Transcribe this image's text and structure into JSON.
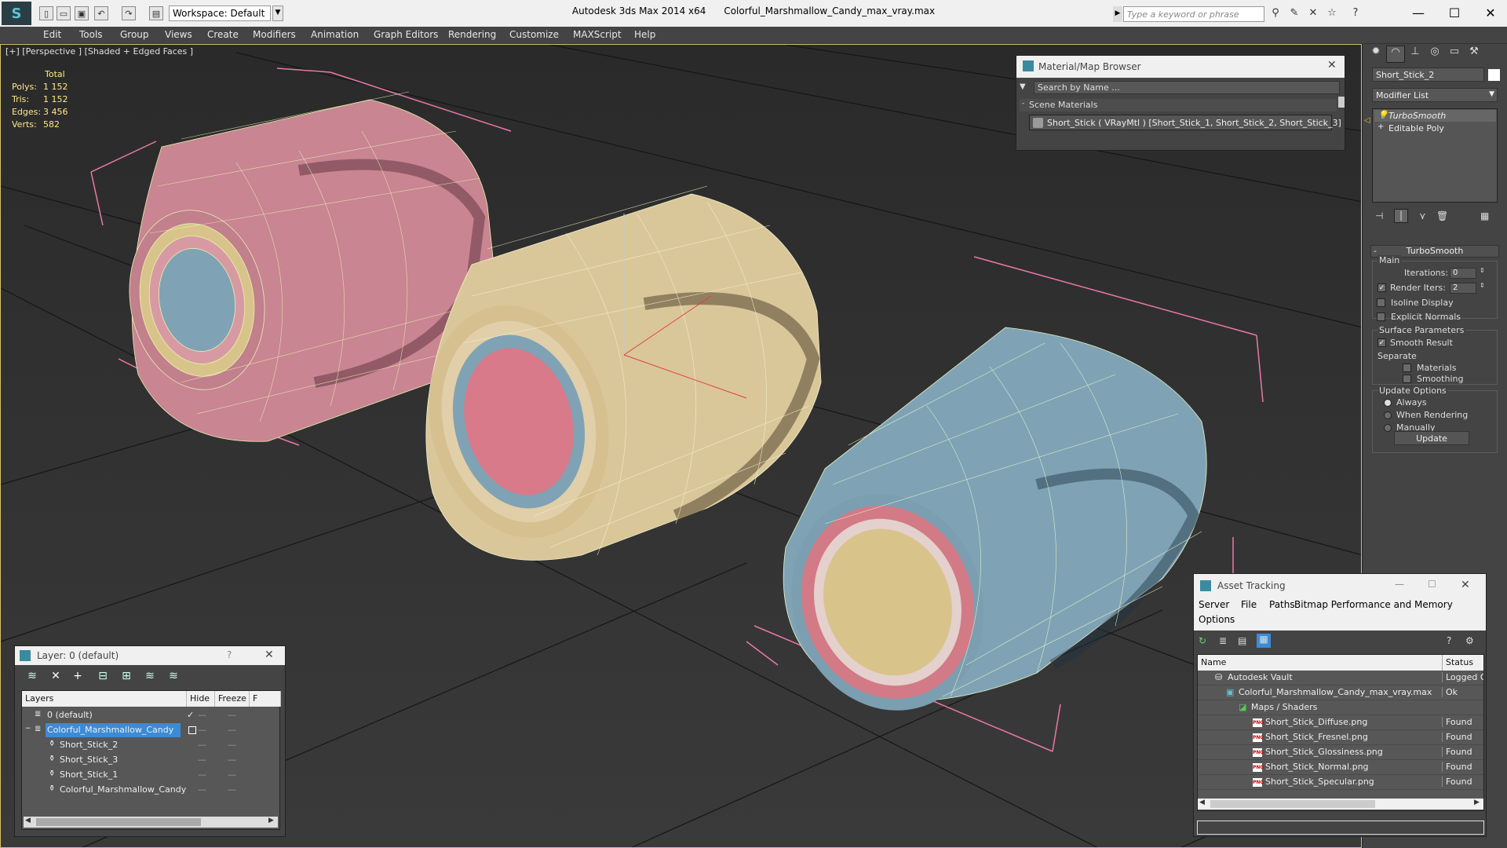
{
  "titlebar": {
    "workspace": "Workspace: Default",
    "app_name": "Autodesk 3ds Max  2014 x64",
    "file_name": "Colorful_Marshmallow_Candy_max_vray.max",
    "search_placeholder": "Type a keyword or phrase"
  },
  "menu": [
    "Edit",
    "Tools",
    "Group",
    "Views",
    "Create",
    "Modifiers",
    "Animation",
    "Graph Editors",
    "Rendering",
    "Customize",
    "MAXScript",
    "Help"
  ],
  "viewport": {
    "label": "[+] [Perspective ] [Shaded + Edged Faces ]",
    "stats_header": "Total",
    "stats": [
      {
        "label": "Polys:",
        "value": "1 152"
      },
      {
        "label": "Tris:",
        "value": "1 152"
      },
      {
        "label": "Edges:",
        "value": "3 456"
      },
      {
        "label": "Verts:",
        "value": "582"
      }
    ]
  },
  "material_browser": {
    "title": "Material/Map Browser",
    "search_placeholder": "Search by Name ...",
    "section": "Scene Materials",
    "material": "Short_Stick  ( VRayMtl )  [Short_Stick_1, Short_Stick_2, Short_Stick_3]"
  },
  "command_panel": {
    "object_name": "Short_Stick_2",
    "modifier_list": "Modifier List",
    "stack": [
      "TurboSmooth",
      "Editable Poly"
    ],
    "rollout_title": "TurboSmooth",
    "main_label": "Main",
    "iterations_label": "Iterations:",
    "iterations_value": "0",
    "render_iters_label": "Render Iters:",
    "render_iters_value": "2",
    "isoline": "Isoline Display",
    "explicit_normals": "Explicit Normals",
    "surface_params": "Surface Parameters",
    "smooth_result": "Smooth Result",
    "separate": "Separate",
    "materials": "Materials",
    "smoothing_groups": "Smoothing Groups",
    "update_options": "Update Options",
    "always": "Always",
    "when_rendering": "When Rendering",
    "manually": "Manually",
    "update_button": "Update"
  },
  "layer_panel": {
    "title": "Layer: 0 (default)",
    "help": "?",
    "columns": [
      "Layers",
      "Hide",
      "Freeze",
      "F"
    ],
    "rows": [
      {
        "name": "0 (default)",
        "hide": "—",
        "freeze": "—"
      },
      {
        "name": "Colorful_Marshmallow_Candy",
        "hide": "—",
        "freeze": "—"
      },
      {
        "name": "Short_Stick_2",
        "hide": "—",
        "freeze": "—"
      },
      {
        "name": "Short_Stick_3",
        "hide": "—",
        "freeze": "—"
      },
      {
        "name": "Short_Stick_1",
        "hide": "—",
        "freeze": "—"
      },
      {
        "name": "Colorful_Marshmallow_Candy",
        "hide": "—",
        "freeze": "—"
      }
    ]
  },
  "asset_tracking": {
    "title": "Asset Tracking",
    "menu": [
      "Server",
      "File",
      "Paths",
      "Bitmap Performance and Memory",
      "Options"
    ],
    "columns": [
      "Name",
      "Status"
    ],
    "rows": [
      {
        "name": "Autodesk Vault",
        "status": "Logged Out"
      },
      {
        "name": "Colorful_Marshmallow_Candy_max_vray.max",
        "status": "Ok"
      },
      {
        "name": "Maps / Shaders",
        "status": ""
      },
      {
        "name": "Short_Stick_Diffuse.png",
        "status": "Found"
      },
      {
        "name": "Short_Stick_Fresnel.png",
        "status": "Found"
      },
      {
        "name": "Short_Stick_Glossiness.png",
        "status": "Found"
      },
      {
        "name": "Short_Stick_Normal.png",
        "status": "Found"
      },
      {
        "name": "Short_Stick_Specular.png",
        "status": "Found"
      }
    ]
  },
  "colors": {
    "pink": "#c98592",
    "cream": "#d9c79a",
    "blue": "#7fa3b5",
    "accent": "#3b8bd6"
  }
}
